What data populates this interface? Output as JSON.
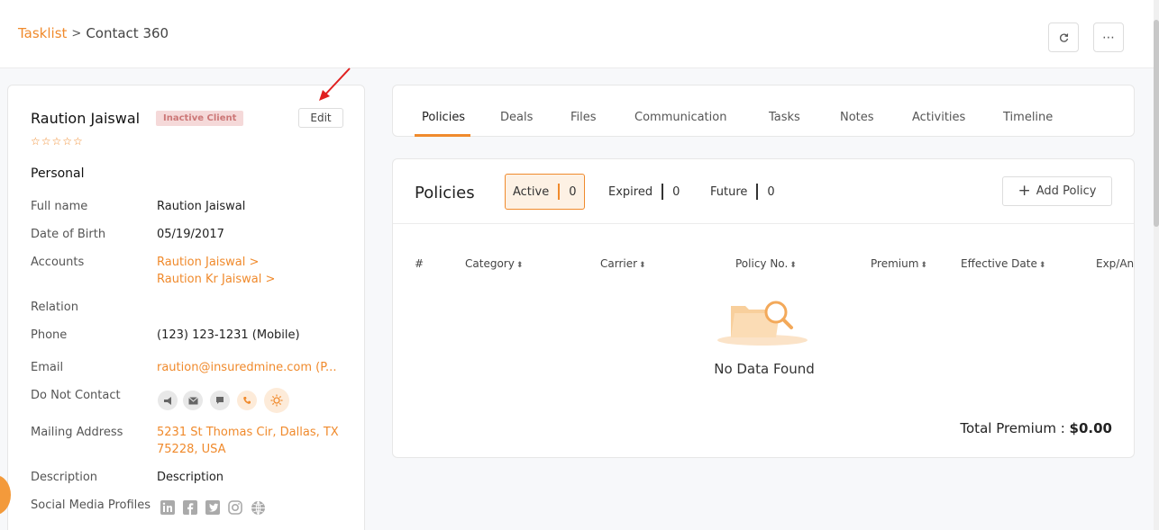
{
  "breadcrumb": {
    "parent": "Tasklist",
    "separator": ">",
    "current": "Contact 360"
  },
  "topbar": {
    "refresh_icon": "refresh-icon",
    "more_icon": "more-icon",
    "more_label": "⋯"
  },
  "client": {
    "name": "Raution Jaiswal",
    "badge": "Inactive Client",
    "edit_label": "Edit",
    "stars": "☆☆☆☆☆",
    "rating": 0,
    "section_title": "Personal",
    "fields": {
      "full_name_label": "Full name",
      "full_name": "Raution Jaiswal",
      "dob_label": "Date of Birth",
      "dob": "05/19/2017",
      "accounts_label": "Accounts",
      "account_1": "Raution Jaiswal >",
      "account_2": "Raution Kr Jaiswal >",
      "relation_label": "Relation",
      "phone_label": "Phone",
      "phone": "(123) 123-1231 (Mobile)",
      "email_label": "Email",
      "email": "raution@insuredmine.com  (P...",
      "dnc_label": "Do Not Contact",
      "address_label": "Mailing Address",
      "address_line1": "5231 St Thomas Cir, Dallas, TX",
      "address_line2": "75228, USA",
      "description_label": "Description",
      "description": "Description",
      "social_label": "Social Media Profiles"
    },
    "dnc_icons": [
      "megaphone-icon",
      "mail-icon",
      "chat-icon",
      "phone-icon",
      "sun-icon"
    ],
    "social_icons": [
      "linkedin-icon",
      "facebook-icon",
      "twitter-icon",
      "instagram-icon",
      "globe-icon"
    ]
  },
  "tabs": [
    "Policies",
    "Deals",
    "Files",
    "Communication",
    "Tasks",
    "Notes",
    "Activities",
    "Timeline"
  ],
  "policies": {
    "title": "Policies",
    "filters": [
      {
        "label": "Active",
        "count": "0"
      },
      {
        "label": "Expired",
        "count": "0"
      },
      {
        "label": "Future",
        "count": "0"
      }
    ],
    "add_label": "Add Policy",
    "columns": [
      "#",
      "Category",
      "Carrier",
      "Policy No.",
      "Premium",
      "Effective Date",
      "Exp/An"
    ],
    "empty_text": "No Data Found",
    "total_label": "Total Premium :",
    "total_value": "$0.00"
  },
  "colors": {
    "accent": "#f08a2c",
    "badge_bg": "#f5d9d9",
    "annotation_arrow": "#e02020"
  }
}
